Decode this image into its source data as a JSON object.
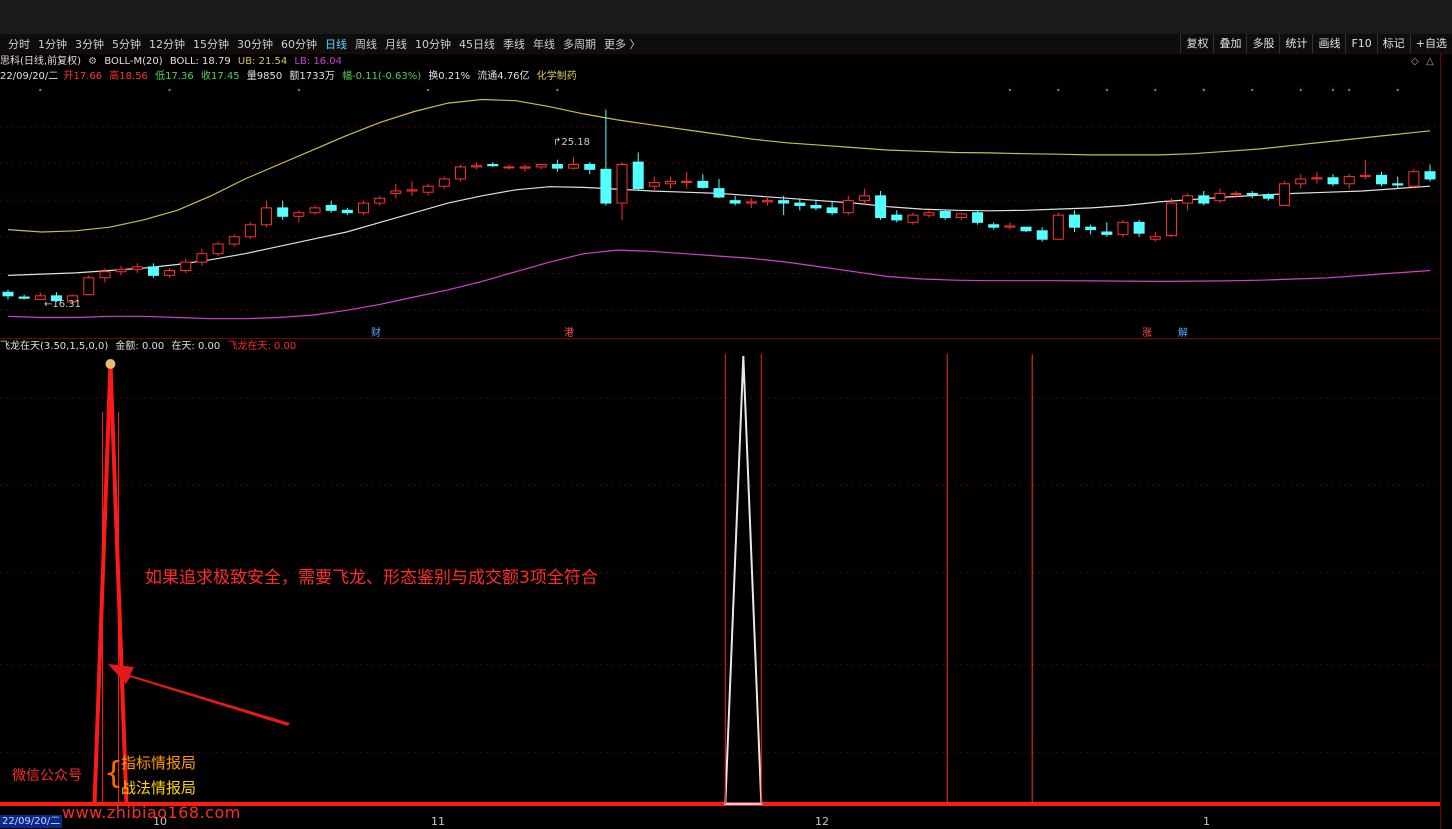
{
  "toolbar": {
    "timeframes": [
      "分时",
      "1分钟",
      "3分钟",
      "5分钟",
      "12分钟",
      "15分钟",
      "30分钟",
      "60分钟",
      "日线",
      "周线",
      "月线",
      "10分钟",
      "45日线",
      "季线",
      "年线",
      "多周期",
      "更多 〉"
    ],
    "active": "日线",
    "tools": [
      "复权",
      "叠加",
      "多股",
      "统计",
      "画线",
      "F10",
      "标记",
      "+自选"
    ]
  },
  "header": {
    "stock": "思科(日线,前复权)",
    "indicator_name": "BOLL-M(20)",
    "boll": "BOLL: 18.79",
    "ub": "UB: 21.54",
    "lb": "LB: 16.04"
  },
  "quote": {
    "date": "22/09/20/二",
    "open": "开17.66",
    "high": "高18.56",
    "low": "低17.36",
    "close": "收17.45",
    "vol": "量9850",
    "amount": "额1733万",
    "change": "幅-0.11(-0.63%)",
    "turnover": "换0.21%",
    "float": "流通4.76亿",
    "sector": "化学制药"
  },
  "price_labels": {
    "high": "25.18",
    "low": "16.31"
  },
  "events": [
    {
      "label": "财",
      "color": "#5aa8ff"
    },
    {
      "label": "港",
      "color": "#ff5050"
    },
    {
      "label": "涨",
      "color": "#ff5050"
    },
    {
      "label": "解",
      "color": "#5aa8ff"
    }
  ],
  "indicator": {
    "name": "飞龙在天(3.50,1,5,0,0)",
    "v1": "金额: 0.00",
    "v2": "在天: 0.00",
    "v3": "飞龙在天: 0.00"
  },
  "annotation": "如果追求极致安全，需要飞龙、形态鉴别与成交额3项全符合",
  "wechat": "微信公众号",
  "accounts": [
    "指标情报局",
    "战法情报局"
  ],
  "watermark": "www.zhibiao168.com",
  "axis": {
    "date": "22/09/20/二",
    "months": [
      "10",
      "11",
      "12",
      "1"
    ]
  },
  "colors": {
    "up": "#ff3030",
    "down": "#54ffff",
    "mid": "#e0e0e0",
    "upper": "#c8c040",
    "lower": "#d040d0"
  },
  "chart_data": {
    "type": "candlestick",
    "ohlc": [
      [
        17.6,
        17.7,
        17.3,
        17.45
      ],
      [
        17.4,
        17.5,
        17.3,
        17.35
      ],
      [
        17.3,
        17.6,
        17.3,
        17.45
      ],
      [
        17.45,
        17.6,
        17.2,
        17.25
      ],
      [
        17.2,
        17.5,
        17.1,
        17.45
      ],
      [
        17.5,
        18.3,
        17.5,
        18.2
      ],
      [
        18.2,
        18.6,
        18.0,
        18.45
      ],
      [
        18.45,
        18.7,
        18.3,
        18.55
      ],
      [
        18.55,
        18.8,
        18.4,
        18.65
      ],
      [
        18.65,
        18.8,
        18.2,
        18.3
      ],
      [
        18.3,
        18.6,
        18.2,
        18.5
      ],
      [
        18.5,
        19.0,
        18.4,
        18.85
      ],
      [
        18.85,
        19.4,
        18.7,
        19.2
      ],
      [
        19.2,
        19.7,
        19.1,
        19.6
      ],
      [
        19.6,
        20.0,
        19.5,
        19.9
      ],
      [
        19.9,
        20.5,
        19.8,
        20.4
      ],
      [
        20.4,
        21.4,
        20.3,
        21.1
      ],
      [
        21.1,
        21.4,
        20.6,
        20.75
      ],
      [
        20.75,
        21.0,
        20.5,
        20.9
      ],
      [
        20.9,
        21.2,
        20.8,
        21.1
      ],
      [
        21.2,
        21.4,
        20.9,
        21.0
      ],
      [
        21.0,
        21.1,
        20.8,
        20.9
      ],
      [
        20.9,
        21.4,
        20.8,
        21.3
      ],
      [
        21.3,
        21.6,
        21.2,
        21.5
      ],
      [
        21.7,
        22.1,
        21.5,
        21.8
      ],
      [
        21.8,
        22.2,
        21.6,
        21.85
      ],
      [
        21.75,
        22.1,
        21.6,
        22.0
      ],
      [
        22.0,
        22.4,
        21.9,
        22.3
      ],
      [
        22.3,
        22.9,
        22.2,
        22.8
      ],
      [
        22.8,
        23.0,
        22.7,
        22.85
      ],
      [
        22.9,
        23.0,
        22.8,
        22.85
      ],
      [
        22.8,
        22.9,
        22.7,
        22.8
      ],
      [
        22.75,
        22.9,
        22.6,
        22.8
      ],
      [
        22.8,
        22.9,
        22.7,
        22.9
      ],
      [
        22.9,
        23.1,
        22.6,
        22.75
      ],
      [
        22.75,
        23.2,
        22.7,
        22.9
      ],
      [
        22.9,
        23.0,
        22.5,
        22.7
      ],
      [
        22.7,
        25.18,
        21.2,
        21.3
      ],
      [
        21.3,
        23.0,
        20.6,
        22.9
      ],
      [
        23.0,
        23.4,
        21.8,
        21.9
      ],
      [
        22.0,
        22.4,
        21.8,
        22.15
      ],
      [
        22.1,
        22.4,
        21.9,
        22.2
      ],
      [
        22.2,
        22.6,
        21.9,
        22.2
      ],
      [
        22.2,
        22.5,
        21.9,
        21.95
      ],
      [
        21.9,
        22.3,
        21.5,
        21.55
      ],
      [
        21.4,
        21.6,
        21.2,
        21.3
      ],
      [
        21.3,
        21.5,
        21.1,
        21.35
      ],
      [
        21.35,
        21.6,
        21.2,
        21.4
      ],
      [
        21.4,
        21.6,
        20.8,
        21.3
      ],
      [
        21.3,
        21.5,
        21.0,
        21.2
      ],
      [
        21.2,
        21.4,
        21.0,
        21.1
      ],
      [
        21.1,
        21.4,
        20.8,
        20.9
      ],
      [
        20.9,
        21.6,
        20.8,
        21.4
      ],
      [
        21.4,
        21.9,
        21.2,
        21.6
      ],
      [
        21.6,
        21.8,
        20.6,
        20.7
      ],
      [
        20.8,
        21.0,
        20.5,
        20.6
      ],
      [
        20.5,
        20.9,
        20.4,
        20.8
      ],
      [
        20.8,
        21.0,
        20.7,
        20.9
      ],
      [
        20.95,
        21.0,
        20.6,
        20.7
      ],
      [
        20.7,
        20.9,
        20.6,
        20.85
      ],
      [
        20.9,
        21.0,
        20.4,
        20.5
      ],
      [
        20.4,
        20.5,
        20.2,
        20.3
      ],
      [
        20.3,
        20.5,
        20.2,
        20.35
      ],
      [
        20.3,
        20.3,
        20.1,
        20.15
      ],
      [
        20.15,
        20.3,
        19.7,
        19.8
      ],
      [
        19.8,
        20.9,
        19.8,
        20.8
      ],
      [
        20.8,
        21.0,
        20.1,
        20.3
      ],
      [
        20.3,
        20.4,
        20.0,
        20.2
      ],
      [
        20.1,
        20.5,
        19.9,
        20.0
      ],
      [
        20.0,
        20.6,
        19.9,
        20.5
      ],
      [
        20.5,
        20.6,
        19.9,
        20.05
      ],
      [
        19.8,
        20.1,
        19.7,
        19.9
      ],
      [
        19.95,
        21.5,
        19.9,
        21.3
      ],
      [
        21.3,
        21.7,
        21.0,
        21.6
      ],
      [
        21.6,
        21.8,
        21.2,
        21.3
      ],
      [
        21.4,
        21.9,
        21.3,
        21.7
      ],
      [
        21.7,
        21.8,
        21.5,
        21.7
      ],
      [
        21.7,
        21.8,
        21.5,
        21.65
      ],
      [
        21.65,
        21.7,
        21.4,
        21.5
      ],
      [
        21.2,
        22.2,
        21.2,
        22.1
      ],
      [
        22.1,
        22.5,
        21.9,
        22.3
      ],
      [
        22.3,
        22.6,
        22.1,
        22.35
      ],
      [
        22.35,
        22.5,
        22.0,
        22.1
      ],
      [
        22.1,
        22.5,
        21.9,
        22.4
      ],
      [
        22.4,
        23.1,
        22.3,
        22.45
      ],
      [
        22.45,
        22.6,
        22.0,
        22.1
      ],
      [
        22.1,
        22.4,
        21.9,
        22.05
      ],
      [
        22.0,
        22.7,
        21.9,
        22.6
      ],
      [
        22.6,
        22.9,
        22.2,
        22.3
      ]
    ],
    "boll_mid": [
      18.3,
      18.35,
      18.4,
      18.5,
      18.6,
      18.75,
      18.95,
      19.2,
      19.5,
      19.8,
      20.1,
      20.5,
      20.9,
      21.3,
      21.6,
      21.85,
      21.98,
      21.95,
      21.88,
      21.8,
      21.75,
      21.7,
      21.6,
      21.5,
      21.4,
      21.3,
      21.15,
      21.05,
      21.0,
      20.98,
      21.0,
      21.05,
      21.1,
      21.2,
      21.35,
      21.45,
      21.55,
      21.63,
      21.7,
      21.75,
      21.8,
      21.9,
      22.0
    ],
    "boll_upper": [
      20.2,
      20.1,
      20.15,
      20.3,
      20.6,
      21.0,
      21.6,
      22.3,
      22.9,
      23.5,
      24.1,
      24.65,
      25.1,
      25.45,
      25.6,
      25.55,
      25.3,
      25.0,
      24.75,
      24.55,
      24.35,
      24.15,
      23.95,
      23.8,
      23.7,
      23.6,
      23.5,
      23.45,
      23.4,
      23.38,
      23.35,
      23.33,
      23.3,
      23.3,
      23.3,
      23.35,
      23.45,
      23.55,
      23.7,
      23.85,
      24.0,
      24.15,
      24.3
    ],
    "boll_lower": [
      16.6,
      16.55,
      16.55,
      16.6,
      16.6,
      16.55,
      16.5,
      16.5,
      16.55,
      16.65,
      16.85,
      17.1,
      17.4,
      17.7,
      18.05,
      18.45,
      18.85,
      19.2,
      19.35,
      19.3,
      19.2,
      19.1,
      19.0,
      18.85,
      18.65,
      18.45,
      18.25,
      18.15,
      18.1,
      18.08,
      18.08,
      18.08,
      18.07,
      18.06,
      18.05,
      18.06,
      18.07,
      18.1,
      18.15,
      18.2,
      18.3,
      18.4,
      18.5
    ],
    "indicator_series": [
      {
        "color": "#ff1a1a",
        "segments": [
          [
            0,
            0
          ],
          [
            3,
            1
          ],
          [
            4,
            0
          ]
        ]
      },
      {
        "color": "#ff1a1a",
        "segments": [
          [
            4,
            0
          ],
          [
            88,
            0
          ]
        ]
      }
    ],
    "indicator_peaks": [
      3,
      46
    ],
    "indicator_lines": [
      58,
      64
    ]
  }
}
